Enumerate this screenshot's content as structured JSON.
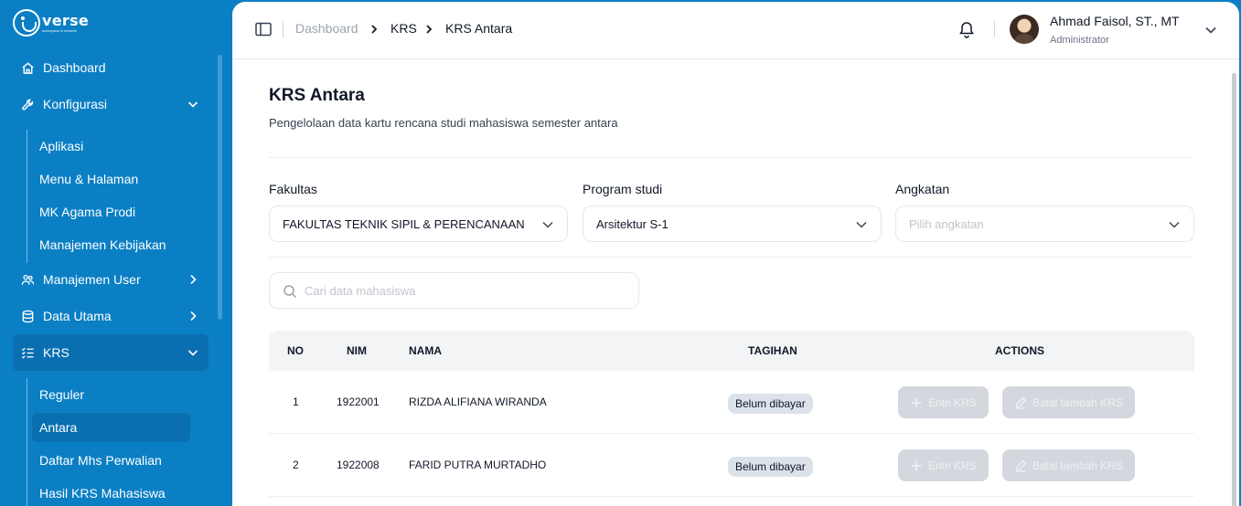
{
  "logo": {
    "word": "verse",
    "tagline": "workspace & network"
  },
  "sidebar": {
    "items": [
      {
        "label": "Dashboard",
        "icon": "home-icon"
      },
      {
        "label": "Konfigurasi",
        "icon": "wrench-icon",
        "expanded": true,
        "children": [
          "Aplikasi",
          "Menu & Halaman",
          "MK Agama Prodi",
          "Manajemen Kebijakan"
        ]
      },
      {
        "label": "Manajemen User",
        "icon": "users-icon",
        "expanded": false
      },
      {
        "label": "Data Utama",
        "icon": "database-icon",
        "expanded": false
      },
      {
        "label": "KRS",
        "icon": "checklist-icon",
        "expanded": true,
        "active": true,
        "children": [
          "Reguler",
          "Antara",
          "Daftar Mhs Perwalian",
          "Hasil KRS Mahasiswa"
        ],
        "active_child": "Antara"
      }
    ]
  },
  "breadcrumb": [
    "Dashboard",
    "KRS",
    "KRS Antara"
  ],
  "user": {
    "name": "Ahmad Faisol, ST., MT",
    "role": "Administrator"
  },
  "page": {
    "title": "KRS Antara",
    "subtitle": "Pengelolaan data kartu rencana studi mahasiswa semester antara"
  },
  "filters": {
    "fakultas": {
      "label": "Fakultas",
      "value": "FAKULTAS TEKNIK SIPIL & PERENCANAAN"
    },
    "prodi": {
      "label": "Program studi",
      "value": "Arsitektur S-1"
    },
    "angkatan": {
      "label": "Angkatan",
      "placeholder": "Pilih angkatan"
    }
  },
  "search": {
    "placeholder": "Cari data mahasiswa"
  },
  "table": {
    "headers": {
      "no": "NO",
      "nim": "NIM",
      "nama": "NAMA",
      "tagihan": "TAGIHAN",
      "actions": "ACTIONS"
    },
    "rows": [
      {
        "no": "1",
        "nim": "1922001",
        "nama": "RIZDA ALIFIANA WIRANDA",
        "tagihan": "Belum dibayar"
      },
      {
        "no": "2",
        "nim": "1922008",
        "nama": "FARID PUTRA MURTADHO",
        "tagihan": "Belum dibayar"
      }
    ],
    "actions": {
      "entri": "Entri KRS",
      "batal": "Batal tambah KRS"
    }
  },
  "colors": {
    "sidebar": "#0b7fc4",
    "sidebar_active": "#0a6fb0",
    "badge": "#dbe2ea",
    "disabled_button": "#d4d8de"
  }
}
